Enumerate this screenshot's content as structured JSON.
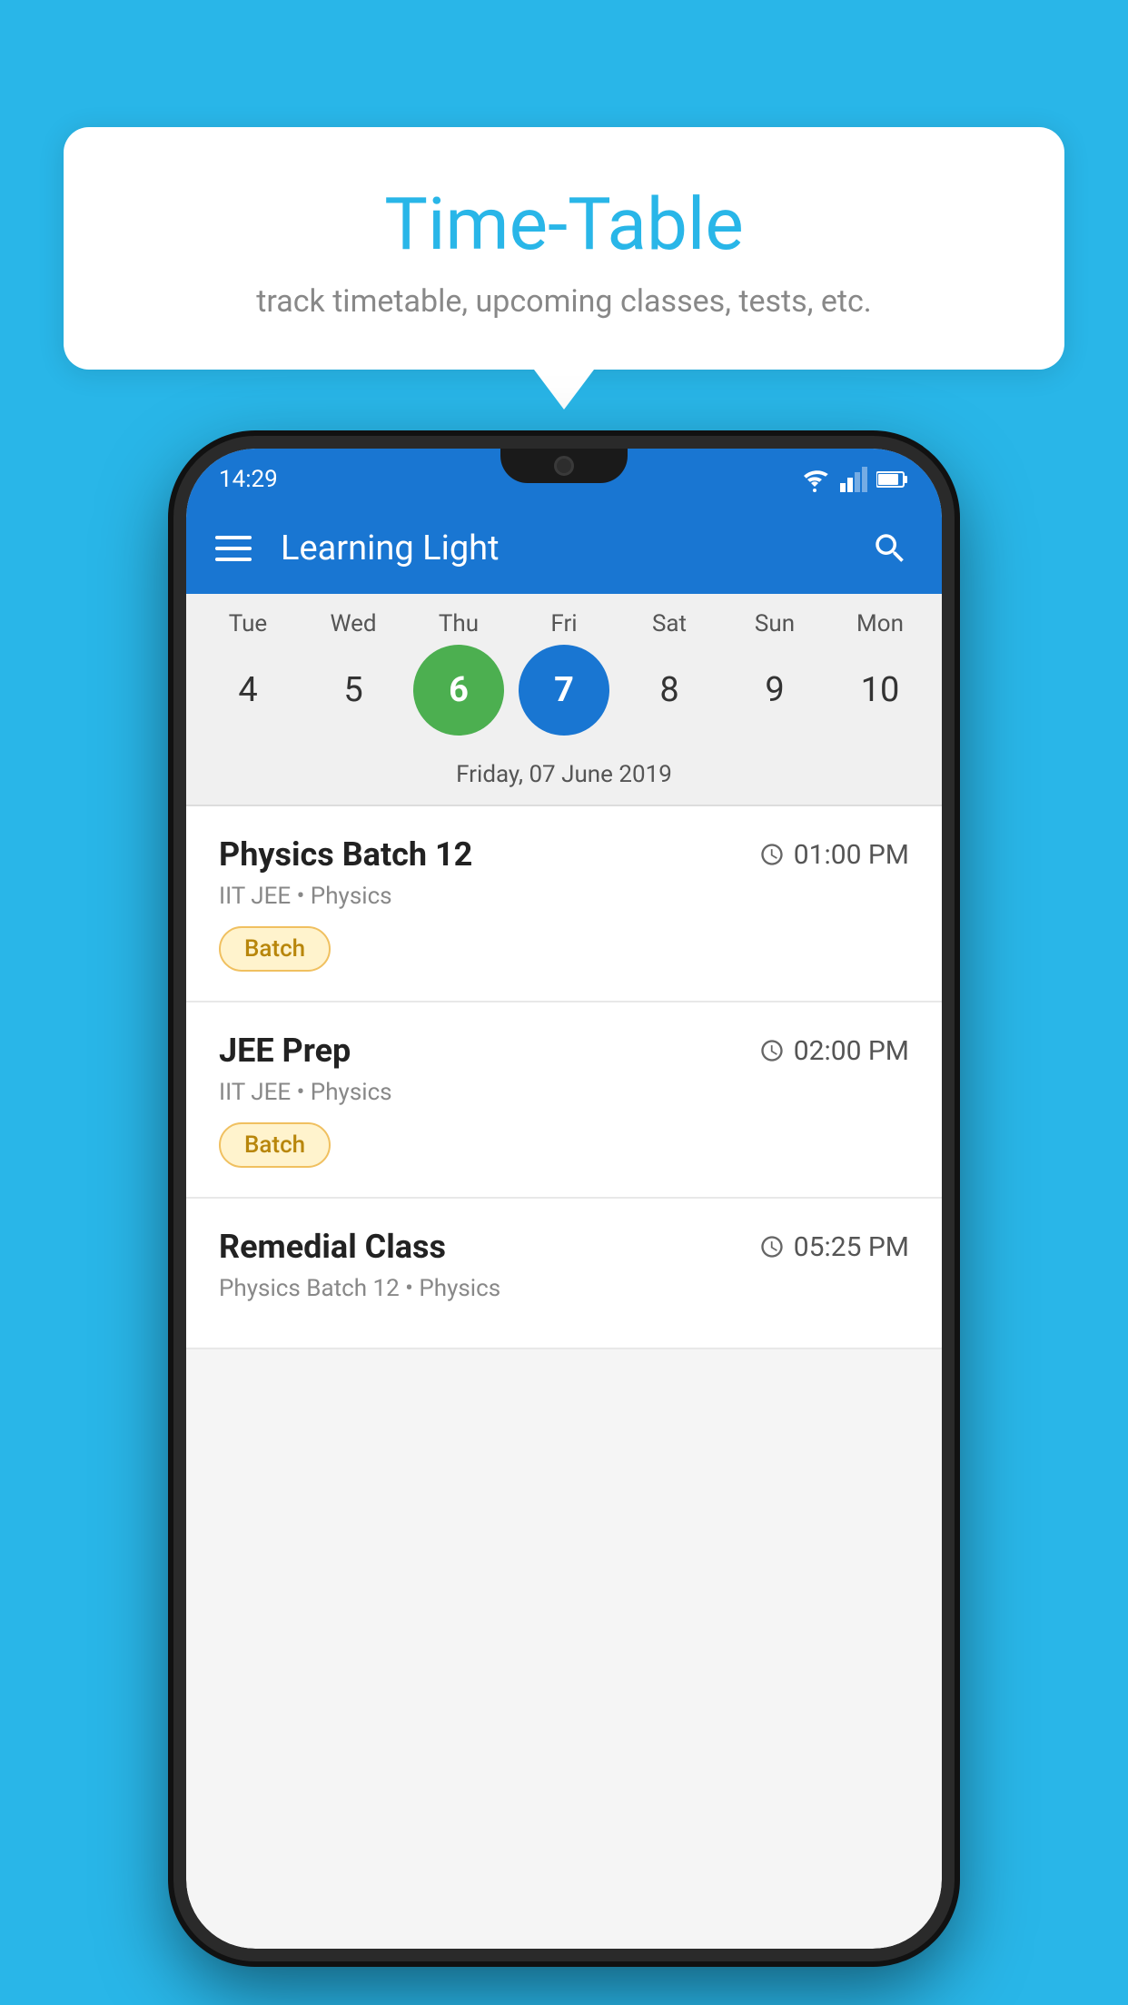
{
  "background": {
    "color": "#29B6E8"
  },
  "tooltip": {
    "title": "Time-Table",
    "subtitle": "track timetable, upcoming classes, tests, etc."
  },
  "phone": {
    "status_bar": {
      "time": "14:29"
    },
    "app_bar": {
      "title": "Learning Light"
    },
    "calendar": {
      "days": [
        {
          "label": "Tue",
          "number": "4"
        },
        {
          "label": "Wed",
          "number": "5"
        },
        {
          "label": "Thu",
          "number": "6",
          "state": "today"
        },
        {
          "label": "Fri",
          "number": "7",
          "state": "selected"
        },
        {
          "label": "Sat",
          "number": "8"
        },
        {
          "label": "Sun",
          "number": "9"
        },
        {
          "label": "Mon",
          "number": "10"
        }
      ],
      "selected_date_label": "Friday, 07 June 2019"
    },
    "schedule": [
      {
        "name": "Physics Batch 12",
        "time": "01:00 PM",
        "meta": "IIT JEE • Physics",
        "badge": "Batch"
      },
      {
        "name": "JEE Prep",
        "time": "02:00 PM",
        "meta": "IIT JEE • Physics",
        "badge": "Batch"
      },
      {
        "name": "Remedial Class",
        "time": "05:25 PM",
        "meta": "Physics Batch 12 • Physics",
        "badge": null
      }
    ]
  }
}
